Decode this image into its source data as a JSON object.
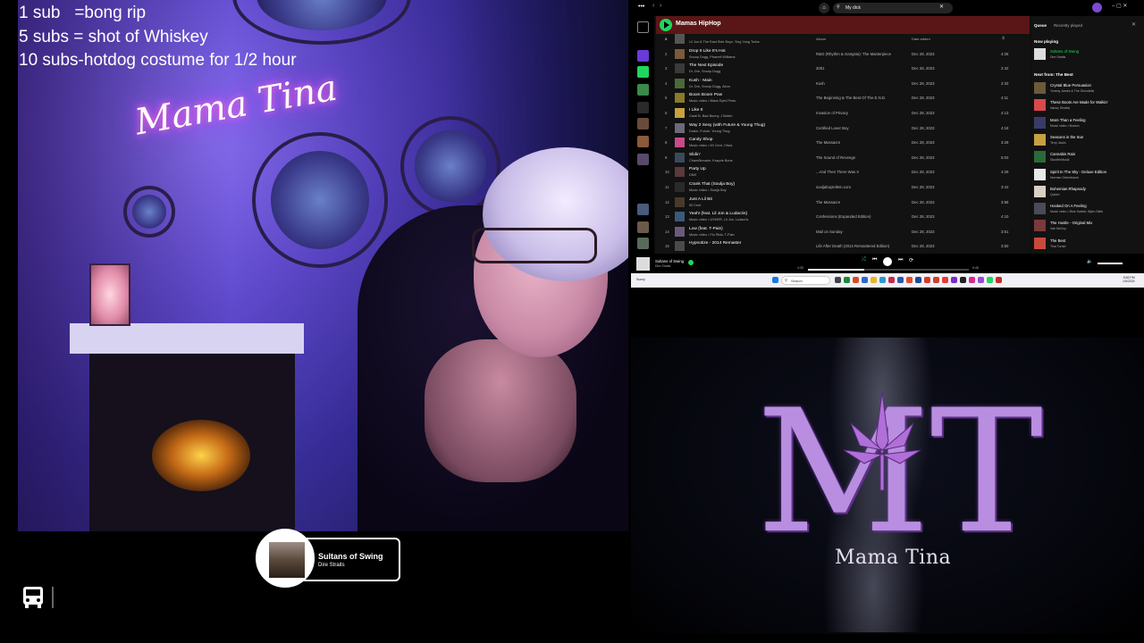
{
  "stream_overlay": {
    "goals": [
      "1 sub   =bong rip",
      "5 subs = shot of Whiskey",
      "10 subs-hotdog costume for 1/2 hour"
    ],
    "neon_sign": "Mama Tina"
  },
  "now_playing_widget": {
    "title": "Sultans of Swing",
    "artist": "Dire Straits"
  },
  "spotify": {
    "search_value": "My dick",
    "playlist_name": "Mamas HipHop",
    "columns": {
      "num": "#",
      "title": "Title",
      "album": "Album",
      "date": "Date added",
      "duration": "⏱"
    },
    "tracks": [
      {
        "n": "1",
        "title": "",
        "artist": "Lil Jon & The East Side Boyz, Ying Yang Twins",
        "album": "",
        "date": "",
        "dur": ""
      },
      {
        "n": "2",
        "title": "Drop It Like It's Hot",
        "artist": "Snoop Dogg, Pharrell Williams",
        "album": "R&G (Rhythm & Gangsta): The Masterpiece",
        "date": "Dec 28, 2023",
        "dur": "4:26"
      },
      {
        "n": "3",
        "title": "The Next Episode",
        "artist": "Dr. Dre, Snoop Dogg",
        "album": "2001",
        "date": "Dec 28, 2023",
        "dur": "2:42"
      },
      {
        "n": "4",
        "title": "Kush - Main",
        "artist": "Dr. Dre, Snoop Dogg, Akon",
        "album": "Kush",
        "date": "Dec 28, 2023",
        "dur": "2:33"
      },
      {
        "n": "5",
        "title": "Boom Boom Pow",
        "artist": "Music video • Black Eyed Peas",
        "album": "The Beginning & The Best Of The E.N.D.",
        "date": "Dec 28, 2023",
        "dur": "4:11"
      },
      {
        "n": "6",
        "title": "I Like It",
        "artist": "Cardi B, Bad Bunny, J Balvin",
        "album": "Invasion of Privacy",
        "date": "Dec 28, 2023",
        "dur": "4:13"
      },
      {
        "n": "7",
        "title": "Way 2 Sexy (with Future & Young Thug)",
        "artist": "Drake, Future, Young Thug",
        "album": "Certified Lover Boy",
        "date": "Dec 28, 2023",
        "dur": "4:18"
      },
      {
        "n": "8",
        "title": "Candy Shop",
        "artist": "Music video • 50 Cent, Olivia",
        "album": "The Massacre",
        "date": "Dec 28, 2023",
        "dur": "3:29"
      },
      {
        "n": "9",
        "title": "Slidin'",
        "artist": "Chamillionaire, Krayzie Bone",
        "album": "The Sound of Revenge",
        "date": "Dec 28, 2023",
        "dur": "5:03"
      },
      {
        "n": "10",
        "title": "Party Up",
        "artist": "DMX",
        "album": "...And Then There Was X",
        "date": "Dec 28, 2023",
        "dur": "4:29"
      },
      {
        "n": "11",
        "title": "Crank That (Soulja Boy)",
        "artist": "Music video • Soulja Boy",
        "album": "souljaboytellem.com",
        "date": "Dec 28, 2023",
        "dur": "3:42"
      },
      {
        "n": "12",
        "title": "Just A Lil Bit",
        "artist": "50 Cent",
        "album": "The Massacre",
        "date": "Dec 28, 2023",
        "dur": "3:58"
      },
      {
        "n": "13",
        "title": "Yeah! (feat. Lil Jon & Ludacris)",
        "artist": "Music video • USHER, Lil Jon, Ludacris",
        "album": "Confessions (Expanded Edition)",
        "date": "Dec 28, 2023",
        "dur": "4:10"
      },
      {
        "n": "14",
        "title": "Low (feat. T-Pain)",
        "artist": "Music video • Flo Rida, T-Pain",
        "album": "Mail on Sunday",
        "date": "Dec 28, 2023",
        "dur": "3:51"
      },
      {
        "n": "15",
        "title": "Hypnotize - 2014 Remaster",
        "artist": "",
        "album": "Life After Death (2014 Remastered Edition)",
        "date": "Dec 28, 2023",
        "dur": "3:50"
      }
    ],
    "queue_tabs": [
      "Queue",
      "Recently played"
    ],
    "now_playing_label": "Now playing",
    "now_playing": {
      "title": "Sultans of Swing",
      "artist": "Dire Straits"
    },
    "next_from_label": "Next from: The Best",
    "queue": [
      {
        "title": "Crystal Blue Persuasion",
        "artist": "Tommy James & The Shondells"
      },
      {
        "title": "These Boots Are Made for Walkin'",
        "artist": "Nancy Sinatra"
      },
      {
        "title": "More Than a Feeling",
        "artist": "Music video • Boston"
      },
      {
        "title": "Seasons in the Sun",
        "artist": "Terry Jacks"
      },
      {
        "title": "Cannabis Rain",
        "artist": "StoufferMusik"
      },
      {
        "title": "Spirit In The Sky - Deluxe Edition",
        "artist": "Norman Greenbaum"
      },
      {
        "title": "Bohemian Rhapsody",
        "artist": "Queen"
      },
      {
        "title": "Hooked On A Feeling",
        "artist": "Music video • Blue Swede, Björn Skifs"
      },
      {
        "title": "The Hustle - Original Mix",
        "artist": "Van McCoy"
      },
      {
        "title": "The Best",
        "artist": "Tina Turner"
      }
    ],
    "player": {
      "title": "Sultans of Swing",
      "artist": "Dire Straits",
      "elapsed": "4:35",
      "total": "5:48",
      "progress": 0.35
    },
    "taskbar": {
      "search_placeholder": "Search",
      "weather": "Sunny",
      "time": "9:56 PM",
      "date": "1/5/2024"
    }
  },
  "logo": {
    "monogram": "MT",
    "text": "Mama Tina"
  },
  "colors": {
    "spotify_green": "#1ed760",
    "neon": "#c24bff",
    "logo_purple": "#b98ee0"
  }
}
